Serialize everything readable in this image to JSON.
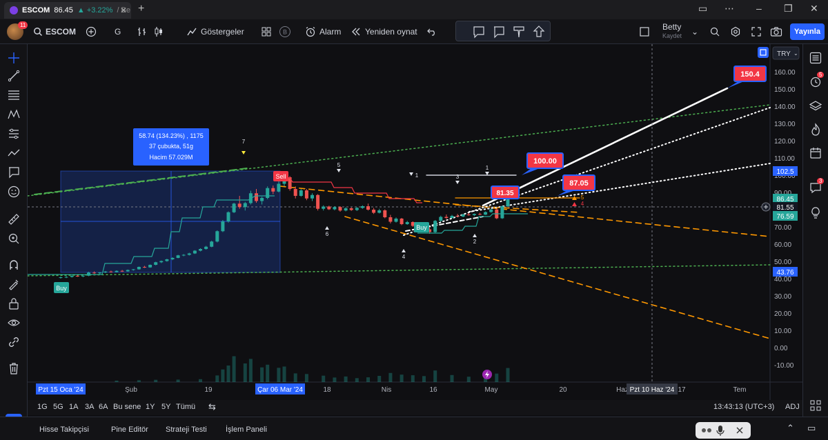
{
  "browser": {
    "tab_symbol": "ESCOM",
    "tab_price": "86.45",
    "tab_change": "▲ +3.22%",
    "tab_suffix": "/ Be"
  },
  "toolbar": {
    "avatar_badge": "11",
    "symbol": "ESCOM",
    "interval": "G",
    "indicators_label": "Göstergeler",
    "alert_label": "Alarm",
    "replay_label": "Yeniden oynat",
    "layout_name": "Betty",
    "layout_status": "Kaydet",
    "publish_label": "Yayınla"
  },
  "right_panel": {
    "badge_alerts": "5",
    "badge_notifications": "3"
  },
  "chart": {
    "currency": "TRY",
    "price_ticks": [
      "160.00",
      "150.00",
      "140.00",
      "130.00",
      "120.00",
      "110.00",
      "100.00",
      "90.00",
      "80.00",
      "70.00",
      "60.00",
      "50.00",
      "40.00",
      "30.00",
      "20.00",
      "10.00",
      "0.00",
      "-10.00"
    ],
    "price_tags": {
      "p102": "102.5",
      "p86": "86.45",
      "p81": "81.55",
      "p76": "76.59",
      "p43": "43.76"
    },
    "time_ticks": [
      "Şub",
      "19",
      "18",
      "Nis",
      "16",
      "May",
      "20",
      "Haz",
      "17",
      "Tem"
    ],
    "time_tag_start": "Pzt 15 Oca '24",
    "time_tag_mid": "Çar 06 Mar '24",
    "time_tag_cursor": "Pzt 10 Haz '24",
    "measure_box": {
      "line1": "58.74 (134.23%) , 1175",
      "line2": "37 çubukta, 51g",
      "line3": "Hacim 57.029M"
    },
    "targets": {
      "t150": "150.4",
      "t100": "100.00",
      "t87": "87.05",
      "t81": "81.35"
    },
    "signals": {
      "buy": "Buy",
      "sell": "Sell"
    },
    "wave_labels": [
      "7",
      "5",
      "6",
      "4",
      "1",
      "3",
      "1",
      "2",
      "5",
      "4",
      "1"
    ],
    "candles": {
      "ohlc": [
        [
          40.5,
          41.2,
          40.0,
          40.8
        ],
        [
          40.8,
          41.5,
          40.3,
          41.0
        ],
        [
          41.0,
          42.0,
          40.6,
          41.6
        ],
        [
          41.6,
          42.2,
          41.0,
          41.3
        ],
        [
          41.3,
          41.9,
          40.8,
          41.7
        ],
        [
          41.7,
          44.0,
          41.4,
          43.5
        ],
        [
          43.5,
          44.2,
          42.8,
          43.1
        ],
        [
          43.1,
          43.8,
          42.6,
          43.6
        ],
        [
          43.6,
          44.4,
          43.2,
          44.1
        ],
        [
          44.1,
          44.6,
          43.5,
          43.8
        ],
        [
          43.8,
          44.8,
          43.6,
          44.5
        ],
        [
          44.5,
          45.0,
          43.9,
          44.2
        ],
        [
          44.2,
          45.3,
          44.0,
          45.0
        ],
        [
          45.0,
          45.6,
          44.6,
          45.4
        ],
        [
          45.4,
          47.0,
          45.2,
          46.8
        ],
        [
          46.8,
          47.4,
          46.2,
          46.5
        ],
        [
          46.5,
          48.2,
          46.3,
          48.0
        ],
        [
          48.0,
          49.8,
          47.7,
          49.5
        ],
        [
          49.5,
          50.5,
          49.0,
          50.2
        ],
        [
          50.2,
          51.5,
          49.8,
          51.2
        ],
        [
          51.2,
          52.4,
          50.7,
          52.0
        ],
        [
          52.0,
          53.8,
          51.8,
          53.5
        ],
        [
          53.5,
          54.2,
          53.0,
          53.8
        ],
        [
          53.8,
          55.0,
          53.4,
          54.6
        ],
        [
          54.6,
          56.5,
          54.3,
          56.2
        ],
        [
          56.2,
          57.6,
          55.8,
          57.2
        ],
        [
          57.2,
          59.0,
          56.8,
          58.5
        ],
        [
          58.5,
          62.0,
          58.2,
          61.5
        ],
        [
          61.5,
          68.0,
          61.0,
          67.5
        ],
        [
          67.5,
          74.0,
          67.0,
          73.2
        ],
        [
          73.2,
          79.0,
          72.5,
          78.5
        ],
        [
          78.5,
          84.0,
          78.0,
          83.5
        ],
        [
          83.5,
          88.0,
          80.5,
          81.5
        ],
        [
          81.5,
          84.5,
          79.5,
          83.8
        ],
        [
          83.8,
          91.0,
          83.0,
          89.5
        ],
        [
          89.5,
          92.0,
          84.0,
          85.0
        ],
        [
          85.0,
          87.5,
          83.0,
          86.8
        ],
        [
          86.8,
          93.5,
          86.0,
          92.5
        ],
        [
          92.5,
          94.0,
          89.0,
          90.5
        ],
        [
          90.5,
          97.5,
          90.0,
          95.0
        ],
        [
          95.0,
          100.5,
          93.5,
          98.8
        ],
        [
          98.8,
          99.5,
          91.0,
          92.0
        ],
        [
          92.0,
          93.5,
          86.5,
          88.0
        ],
        [
          88.0,
          92.0,
          87.5,
          91.2
        ],
        [
          91.2,
          92.0,
          85.5,
          86.5
        ],
        [
          86.5,
          89.5,
          85.0,
          88.5
        ],
        [
          88.5,
          89.0,
          79.5,
          80.5
        ],
        [
          80.5,
          82.5,
          79.5,
          81.8
        ],
        [
          81.8,
          82.3,
          79.8,
          80.2
        ],
        [
          80.2,
          82.0,
          79.6,
          81.5
        ],
        [
          81.5,
          82.0,
          78.8,
          79.5
        ],
        [
          79.5,
          81.5,
          79.0,
          80.8
        ],
        [
          80.8,
          81.3,
          79.3,
          79.8
        ],
        [
          79.8,
          81.5,
          79.2,
          81.0
        ],
        [
          81.0,
          82.5,
          80.5,
          82.0
        ],
        [
          82.0,
          83.5,
          79.5,
          80.0
        ],
        [
          80.0,
          81.0,
          77.5,
          78.2
        ],
        [
          78.2,
          80.5,
          77.8,
          79.6
        ],
        [
          79.6,
          80.2,
          75.0,
          75.6
        ],
        [
          75.6,
          77.0,
          72.0,
          73.0
        ],
        [
          73.0,
          75.5,
          72.5,
          74.8
        ],
        [
          74.8,
          75.2,
          71.0,
          71.6
        ],
        [
          71.6,
          73.5,
          71.2,
          72.8
        ],
        [
          72.8,
          73.2,
          70.0,
          70.6
        ],
        [
          70.6,
          72.8,
          70.2,
          72.3
        ],
        [
          72.3,
          72.7,
          68.0,
          68.6
        ],
        [
          68.6,
          70.0,
          66.0,
          67.0
        ],
        [
          67.0,
          74.0,
          66.6,
          73.5
        ],
        [
          73.5,
          76.5,
          73.0,
          75.8
        ],
        [
          75.8,
          77.2,
          74.6,
          75.2
        ],
        [
          75.2,
          77.0,
          74.8,
          76.4
        ],
        [
          76.4,
          77.5,
          75.6,
          76.0
        ],
        [
          76.0,
          77.6,
          75.6,
          77.2
        ],
        [
          77.2,
          78.0,
          76.5,
          76.8
        ],
        [
          76.8,
          77.8,
          76.2,
          77.5
        ],
        [
          77.5,
          78.2,
          76.8,
          77.1
        ],
        [
          77.1,
          79.0,
          76.9,
          78.6
        ],
        [
          78.6,
          80.5,
          78.2,
          80.1
        ],
        [
          80.1,
          80.6,
          74.5,
          75.0
        ],
        [
          75.0,
          82.5,
          74.6,
          82.0
        ],
        [
          82.0,
          87.0,
          81.6,
          86.45
        ]
      ]
    },
    "volume": {
      "candle_indices": [
        10,
        14,
        17,
        21,
        25,
        28,
        29,
        30,
        31,
        33,
        34,
        36,
        37,
        39,
        40,
        42,
        44,
        47,
        49,
        51,
        53,
        55,
        57,
        59,
        61,
        63,
        65,
        67,
        70,
        73,
        76,
        78,
        80
      ],
      "values": [
        0.7,
        0.9,
        1.1,
        1.2,
        1.4,
        3.2,
        6.1,
        8.0,
        12.5,
        9.0,
        11.2,
        7.1,
        8.4,
        6.9,
        7.5,
        4.2,
        3.9,
        3.1,
        2.2,
        2.7,
        1.9,
        2.3,
        3.0,
        4.4,
        3.6,
        3.3,
        2.9,
        5.6,
        3.4,
        2.6,
        3.2,
        4.1,
        6.8
      ]
    }
  }
}
